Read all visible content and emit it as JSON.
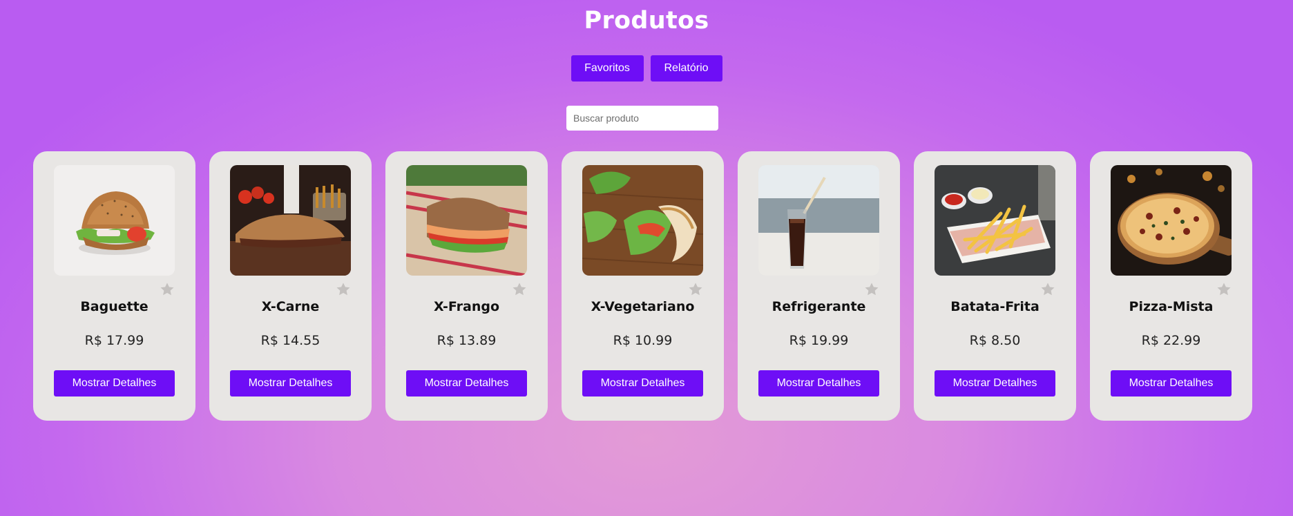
{
  "header": {
    "title": "Produtos"
  },
  "toolbar": {
    "favorites_label": "Favoritos",
    "report_label": "Relatório"
  },
  "search": {
    "placeholder": "Buscar produto",
    "value": ""
  },
  "colors": {
    "accent": "#6e0ef6",
    "card_background": "#e8e6e4",
    "star_inactive": "#c4c1bf"
  },
  "products": [
    {
      "name": "Baguette",
      "price": "R$ 17.99",
      "details_label": "Mostrar Detalhes",
      "favorite": false,
      "image": "baguette-sandwich-image"
    },
    {
      "name": "X-Carne",
      "price": "R$ 14.55",
      "details_label": "Mostrar Detalhes",
      "favorite": false,
      "image": "beef-sandwich-image"
    },
    {
      "name": "X-Frango",
      "price": "R$ 13.89",
      "details_label": "Mostrar Detalhes",
      "favorite": false,
      "image": "chicken-sandwich-image"
    },
    {
      "name": "X-Vegetariano",
      "price": "R$ 10.99",
      "details_label": "Mostrar Detalhes",
      "favorite": false,
      "image": "vegetarian-sandwich-image"
    },
    {
      "name": "Refrigerante",
      "price": "R$ 19.99",
      "details_label": "Mostrar Detalhes",
      "favorite": false,
      "image": "soda-glass-image"
    },
    {
      "name": "Batata-Frita",
      "price": "R$ 8.50",
      "details_label": "Mostrar Detalhes",
      "favorite": false,
      "image": "french-fries-image"
    },
    {
      "name": "Pizza-Mista",
      "price": "R$ 22.99",
      "details_label": "Mostrar Detalhes",
      "favorite": false,
      "image": "pizza-image"
    }
  ]
}
